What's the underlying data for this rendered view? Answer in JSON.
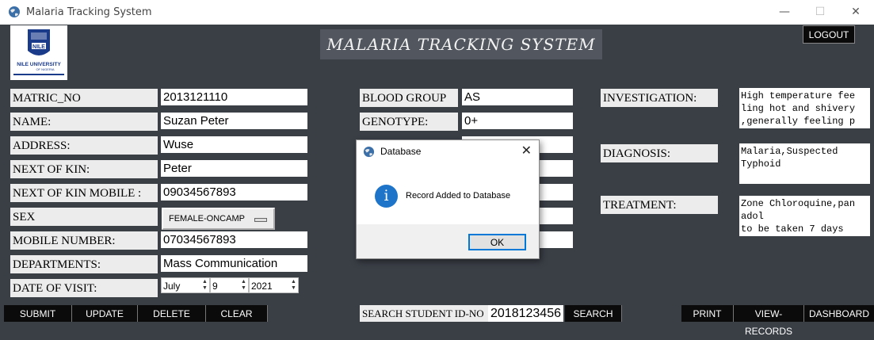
{
  "window": {
    "title": "Malaria Tracking System",
    "minimize": "—",
    "maximize": "☐",
    "close": "✕"
  },
  "logo": {
    "line1": "NILE",
    "line2": "NILE UNIVERSITY",
    "line3": "OF NIGERIA"
  },
  "banner": "MALARIA TRACKING SYSTEM",
  "logout_label": "LOGOUT",
  "form": {
    "matric_label": "MATRIC_NO",
    "matric_value": "2013121110",
    "name_label": "NAME:",
    "name_value": "Suzan  Peter",
    "address_label": "ADDRESS:",
    "address_value": "Wuse",
    "kin_label": "NEXT OF KIN:",
    "kin_value": "Peter",
    "kin_mobile_label": "NEXT OF KIN MOBILE :",
    "kin_mobile_value": "09034567893",
    "sex_label": "SEX",
    "sex_value": "FEMALE-ONCAMP",
    "mobile_label": "MOBILE NUMBER:",
    "mobile_value": "07034567893",
    "dept_label": "DEPARTMENTS:",
    "dept_value": "Mass Communication",
    "visit_label": "DATE OF VISIT:",
    "visit_month": "July",
    "visit_day": "9",
    "visit_year": "2021",
    "blood_label": "BLOOD GROUP",
    "blood_value": "AS",
    "genotype_label": "GENOTYPE:",
    "genotype_value": "0+",
    "investigation_label": "INVESTIGATION:",
    "investigation_value": "High temperature fee\nling hot and shivery\n,generally feeling p",
    "diagnosis_label": "DIAGNOSIS:",
    "diagnosis_value": "Malaria,Suspected\nTyphoid",
    "treatment_label": "TREATMENT:",
    "treatment_value": "Zone Chloroquine,pan\nadol\nto be taken 7 days"
  },
  "buttons": {
    "submit": "SUBMIT",
    "update": "UPDATE",
    "delete": "DELETE",
    "clear": "CLEAR",
    "search_label": "SEARCH STUDENT ID-NO",
    "search_value": "2018123456",
    "search": "SEARCH",
    "print": "PRINT",
    "view_records": "VIEW-RECORDS",
    "dashboard": "DASHBOARD"
  },
  "dialog": {
    "title": "Database",
    "icon": "info-icon",
    "message": "Record Added to Database",
    "ok": "OK",
    "close": "✕"
  },
  "colors": {
    "background": "#3a3f46",
    "banner": "#52575f",
    "button": "#0b0b0b",
    "info": "#1d74c9"
  }
}
